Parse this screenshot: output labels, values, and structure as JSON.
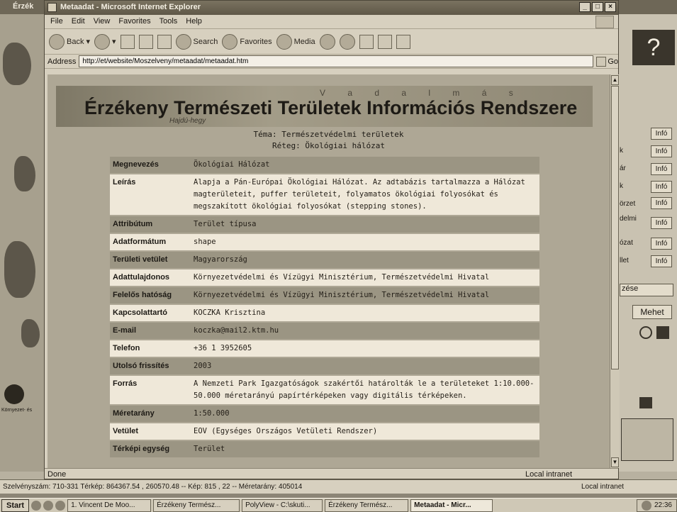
{
  "background_app": {
    "title": "Érzék",
    "side_labels": [
      "k",
      "ár",
      "k",
      "örzet",
      "delmi",
      "ózat",
      "llet"
    ],
    "info_label": "Infó",
    "partial_label": "zése",
    "go_label": "Mehet",
    "help_glyph": "?",
    "compass_label": "Környezet- és"
  },
  "ie": {
    "title": "Metaadat - Microsoft Internet Explorer",
    "menu": [
      "File",
      "Edit",
      "View",
      "Favorites",
      "Tools",
      "Help"
    ],
    "toolbar": {
      "back": "Back",
      "search": "Search",
      "favorites": "Favorites",
      "media": "Media"
    },
    "address_label": "Address",
    "address_value": "http://et/website/Moszelveny/metaadat/metaadat.htm",
    "go_label": "Go",
    "status_text": "Done",
    "zone_text": "Local intranet"
  },
  "page": {
    "banner_title": "Érzékeny Természeti Területek Információs Rendszere",
    "banner_subtitle": "Hajdú-hegy",
    "banner_letters": "V a d a l m á s",
    "theme_line": "Téma: Természetvédelmi területek",
    "layer_line": "Réteg: Ökológiai hálózat",
    "rows": [
      {
        "k": "Megnevezés",
        "v": "Ökológiai Hálózat"
      },
      {
        "k": "Leírás",
        "v": "Alapja a Pán-Európai Ökológiai Hálózat. Az adtabázis tartalmazza a Hálózat magterületeit, puffer területeit, folyamatos ökológiai folyosókat és megszakított ökológiai folyosókat (stepping stones)."
      },
      {
        "k": "Attribútum",
        "v": "Terület típusa"
      },
      {
        "k": "Adatformátum",
        "v": "shape"
      },
      {
        "k": "Területi vetület",
        "v": "Magyarország"
      },
      {
        "k": "Adattulajdonos",
        "v": "Környezetvédelmi és Vízügyi Minisztérium, Természetvédelmi Hivatal"
      },
      {
        "k": "Felelős hatóság",
        "v": "Környezetvédelmi és Vízügyi Minisztérium, Természetvédelmi Hivatal"
      },
      {
        "k": "Kapcsolattartó",
        "v": "KOCZKA Krisztina"
      },
      {
        "k": "E-mail",
        "v": "koczka@mail2.ktm.hu"
      },
      {
        "k": "Telefon",
        "v": "+36 1 3952605"
      },
      {
        "k": "Utolsó frissítés",
        "v": "2003"
      },
      {
        "k": "Forrás",
        "v": "A Nemzeti Park Igazgatóságok szakértői határolták le a területeket 1:10.000-50.000 méretarányú papírtérképeken vagy digitális térképeken."
      },
      {
        "k": "Méretarány",
        "v": "1:50.000"
      },
      {
        "k": "Vetület",
        "v": "EOV (Egységes Országos Vetületi Rendszer)"
      },
      {
        "k": "Térképi egység",
        "v": "Terület"
      }
    ]
  },
  "map_status": {
    "text": "Szelvényszám: 710-331 Térkép: 864367.54 , 260570.48 -- Kép: 815 , 22 -- Méretarány: 405014",
    "zone": "Local intranet"
  },
  "taskbar": {
    "start": "Start",
    "tasks": [
      "1. Vincent De Moo...",
      "Érzékeny Termész...",
      "PolyView - C:\\skuti...",
      "Érzékeny Termész...",
      "Metaadat - Micr..."
    ],
    "clock": "22:36"
  }
}
